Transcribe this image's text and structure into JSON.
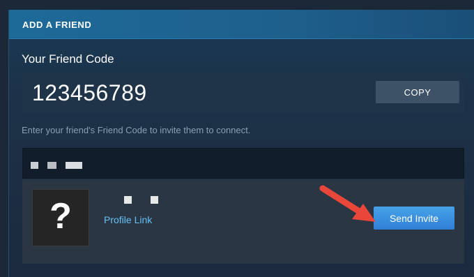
{
  "dialog": {
    "header": "ADD A FRIEND",
    "friend_code_label": "Your Friend Code",
    "friend_code": "123456789",
    "copy_button": "COPY",
    "instructions": "Enter your friend's Friend Code to invite them to connect."
  },
  "result": {
    "avatar_placeholder": "?",
    "profile_link": "Profile Link",
    "send_invite": "Send Invite"
  },
  "colors": {
    "header": "#1d6a99",
    "accent_button": "#2f7fd6",
    "link": "#66c0f4",
    "annotation_arrow": "#e8473a"
  },
  "icons": [
    "question-mark-icon",
    "red-arrow-annotation"
  ]
}
